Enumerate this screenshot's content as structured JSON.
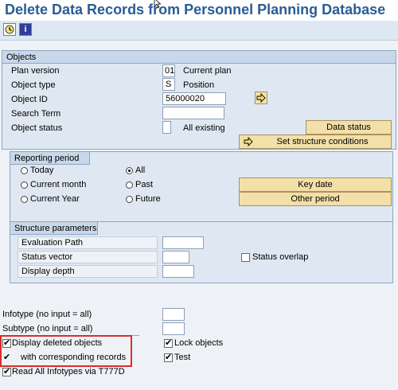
{
  "title": "Delete Data Records from Personnel Planning Database",
  "toolbar": {
    "execute_icon": "execute-icon",
    "info_icon": "info-icon",
    "info_glyph": "i"
  },
  "objects": {
    "header": "Objects",
    "plan_version_label": "Plan version",
    "plan_version_value": "01",
    "plan_version_text": "Current plan",
    "object_type_label": "Object type",
    "object_type_value": "S",
    "object_type_text": "Position",
    "object_id_label": "Object ID",
    "object_id_value": "56000020",
    "search_term_label": "Search Term",
    "search_term_value": "",
    "object_status_label": "Object status",
    "object_status_value": "",
    "object_status_text": "All existing",
    "data_status_button": "Data status",
    "structure_conditions_button": "Set structure conditions"
  },
  "reporting": {
    "header": "Reporting period",
    "today": "Today",
    "current_month": "Current month",
    "current_year": "Current Year",
    "all": "All",
    "past": "Past",
    "future": "Future",
    "selected": "All",
    "key_date_button": "Key date",
    "other_period_button": "Other period"
  },
  "structure": {
    "header": "Structure parameters",
    "evaluation_path_label": "Evaluation Path",
    "status_vector_label": "Status vector",
    "display_depth_label": "Display depth",
    "status_overlap_label": "Status overlap"
  },
  "bottom": {
    "infotype_label": "Infotype (no input = all)",
    "subtype_label": "Subtype (no input = all)",
    "display_deleted_label": "Display deleted objects",
    "with_corresponding_label": "with corresponding records",
    "read_all_label": "Read All Infotypes via T777D",
    "lock_objects_label": "Lock objects",
    "test_label": "Test",
    "check_mark": "✔"
  },
  "colors": {
    "title": "#2a5c93",
    "button": "#f3e0a8",
    "highlight": "#dd2b2b"
  }
}
